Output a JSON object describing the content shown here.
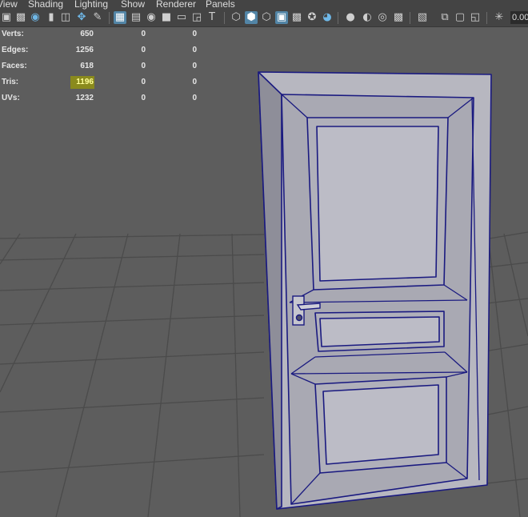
{
  "menubar": {
    "items": [
      "View",
      "Shading",
      "Lighting",
      "Show",
      "Renderer",
      "Panels"
    ]
  },
  "toolbar": {
    "field_value": "0.00",
    "icons": [
      "camera-select-icon",
      "camera-attributes-icon",
      "bookmarks-icon",
      "bookmark-icon",
      "image-plane-icon",
      "2d-pan-zoom-icon",
      "grease-pencil-icon",
      "grid-icon",
      "film-gate-icon",
      "resolution-gate-icon",
      "gate-mask-icon",
      "field-chart-icon",
      "safe-action-icon",
      "safe-title-icon",
      "wireframe-icon",
      "smooth-shade-icon",
      "wireframe-on-shaded-icon",
      "textured-icon",
      "use-all-lights-icon",
      "shadows-icon",
      "screen-space-ao-icon",
      "motion-blur-icon",
      "multisample-aa-icon",
      "depth-of-field-icon",
      "isolate-select-icon",
      "xray-icon",
      "xray-active-components-icon",
      "xray-joints-icon",
      "exposure-icon"
    ]
  },
  "hud": {
    "rows": [
      {
        "label": "Verts:",
        "v1": "650",
        "v2": "0",
        "v3": "0"
      },
      {
        "label": "Edges:",
        "v1": "1256",
        "v2": "0",
        "v3": "0"
      },
      {
        "label": "Faces:",
        "v1": "618",
        "v2": "0",
        "v3": "0"
      },
      {
        "label": "Tris:",
        "v1": "1196",
        "v2": "0",
        "v3": "0"
      },
      {
        "label": "UVs:",
        "v1": "1232",
        "v2": "0",
        "v3": "0"
      }
    ],
    "highlight_color": "#8a8a1d"
  },
  "viewport": {
    "background": "#5d5d5d",
    "grid_color": "#4b4b4b",
    "wire_color": "#1a1a80",
    "door_color": "#b7b7c0",
    "object": "door-model"
  }
}
